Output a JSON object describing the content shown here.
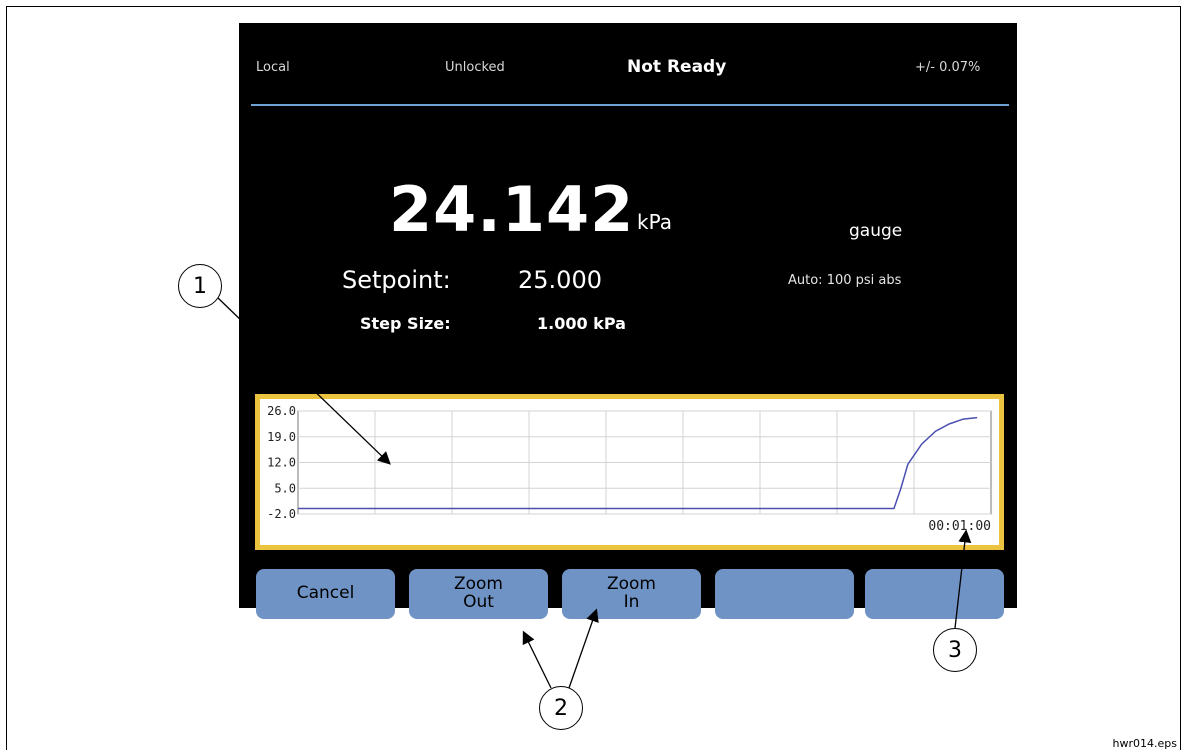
{
  "status_bar": {
    "mode": "Local",
    "lock_state": "Unlocked",
    "ready_state": "Not Ready",
    "accuracy": "+/- 0.07%"
  },
  "reading": {
    "value": "24.142",
    "unit": "kPa",
    "reference": "gauge"
  },
  "setpoint": {
    "label": "Setpoint:",
    "value": "25.000"
  },
  "auto_range": "Auto:  100 psi abs",
  "step": {
    "label": "Step Size:",
    "value": "1.000 kPa"
  },
  "chart_data": {
    "type": "line",
    "y_ticks": [
      "26.0",
      "19.0",
      "12.0",
      "5.0",
      "-2.0"
    ],
    "ylim": [
      -2.0,
      26.0
    ],
    "x_end_label": "00:01:00",
    "grid": true,
    "series": [
      {
        "color": "#4b4fb0",
        "x": [
          0,
          0.86,
          0.87,
          0.88,
          0.9,
          0.92,
          0.94,
          0.96,
          0.98
        ],
        "y": [
          -0.5,
          -0.5,
          5.0,
          11.5,
          17.0,
          20.5,
          22.5,
          23.8,
          24.2
        ]
      }
    ]
  },
  "buttons": [
    {
      "line1": "Cancel",
      "line2": ""
    },
    {
      "line1": "Zoom",
      "line2": "Out"
    },
    {
      "line1": "Zoom",
      "line2": "In"
    },
    {
      "line1": "",
      "line2": ""
    },
    {
      "line1": "",
      "line2": ""
    }
  ],
  "callouts": [
    "1",
    "2",
    "3"
  ],
  "caption": "hwr014.eps",
  "colors": {
    "screen_bg": "#000000",
    "accent_line": "#6fa3d8",
    "chart_border": "#ebc33f",
    "button": "#6f93c4",
    "plot_line": "#4b4fb0"
  }
}
